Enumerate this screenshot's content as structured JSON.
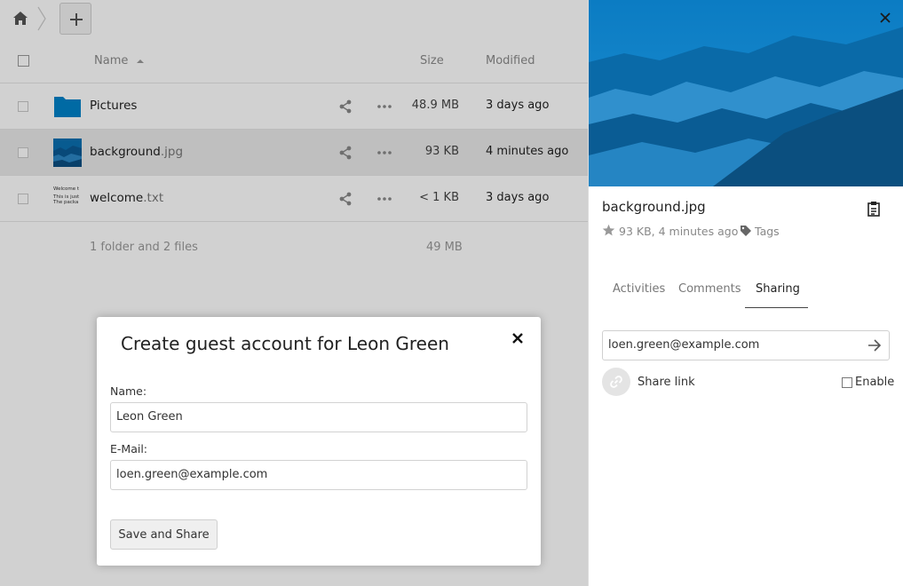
{
  "breadcrumb": {
    "home_icon": "home-icon",
    "add_icon": "plus-icon"
  },
  "table": {
    "headers": {
      "name": "Name",
      "size": "Size",
      "modified": "Modified"
    },
    "rows": [
      {
        "name": "Pictures",
        "ext": "",
        "size": "48.9 MB",
        "modified": "3 days ago",
        "type": "folder"
      },
      {
        "name": "background",
        "ext": ".jpg",
        "size": "93 KB",
        "modified": "4 minutes ago",
        "type": "image"
      },
      {
        "name": "welcome",
        "ext": ".txt",
        "size": "< 1 KB",
        "modified": "3 days ago",
        "type": "text"
      }
    ],
    "summary": {
      "text": "1 folder and 2 files",
      "size": "49 MB"
    },
    "text_thumb_lines": [
      "Welcome t",
      "This is just",
      "The packa"
    ]
  },
  "sidebar": {
    "title": "background.jpg",
    "meta": "93 KB, 4 minutes ago",
    "tags_label": "Tags",
    "tabs": [
      "Activities",
      "Comments",
      "Sharing"
    ],
    "share_input_value": "loen.green@example.com",
    "share_link_label": "Share link",
    "enable_label": "Enable"
  },
  "modal": {
    "title": "Create guest account for Leon Green",
    "name_label": "Name:",
    "name_value": "Leon Green",
    "email_label": "E-Mail:",
    "email_value": "loen.green@example.com",
    "save_label": "Save and Share"
  },
  "colors": {
    "accent": "#0082c9",
    "folder": "#0082c9"
  }
}
